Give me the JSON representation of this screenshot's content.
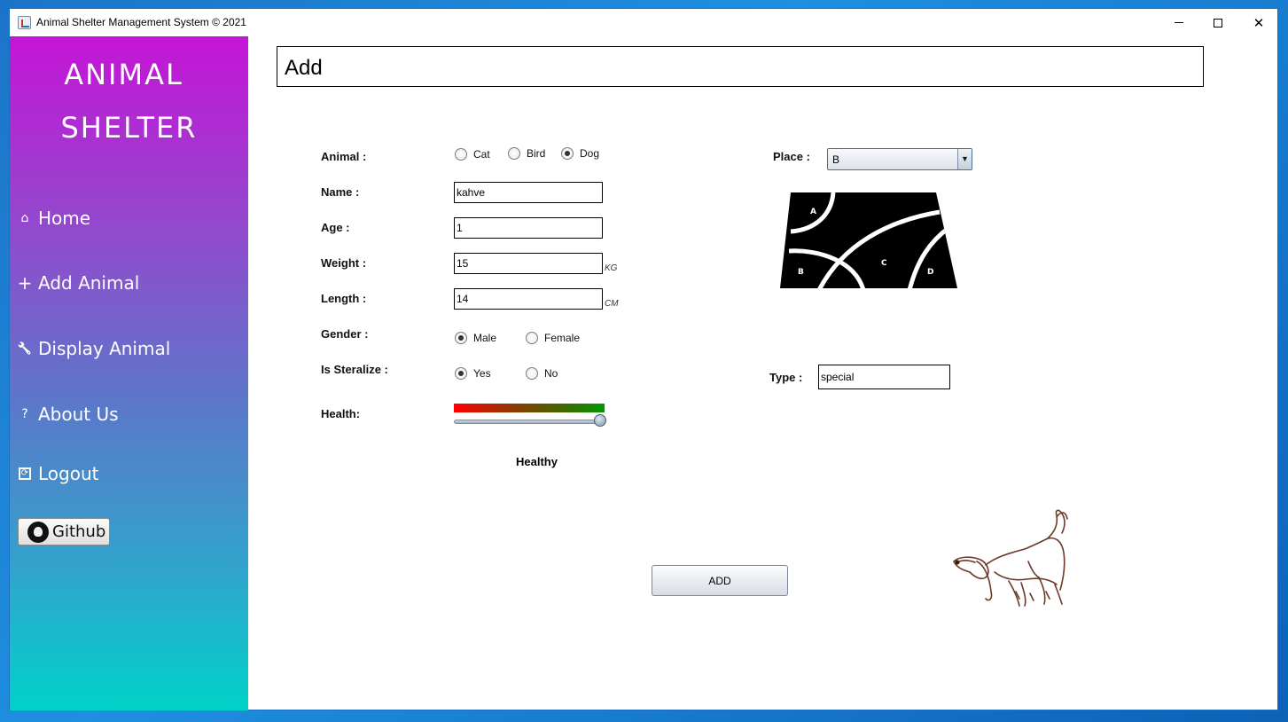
{
  "window": {
    "title": "Animal Shelter Management System © 2021",
    "controls": {
      "minimize": "minimize-icon",
      "maximize": "maximize-icon",
      "close": "✕"
    }
  },
  "sidebar": {
    "brand_line1": "ANIMAL",
    "brand_line2": "SHELTER",
    "items": [
      {
        "icon": "⌂",
        "label": "Home"
      },
      {
        "icon": "+",
        "label": "Add Animal"
      },
      {
        "icon": "🔧",
        "label": "Display Animal"
      },
      {
        "icon": "?",
        "label": "About Us"
      },
      {
        "icon": "⟳",
        "label": "Logout"
      }
    ],
    "github_label": "Github"
  },
  "header": {
    "title": "Add"
  },
  "form": {
    "animal": {
      "label": "Animal :",
      "options": [
        "Cat",
        "Bird",
        "Dog"
      ],
      "selected": "Dog"
    },
    "name": {
      "label": "Name :",
      "value": "kahve"
    },
    "age": {
      "label": "Age :",
      "value": "1"
    },
    "weight": {
      "label": "Weight :",
      "value": "15",
      "unit": "KG"
    },
    "length": {
      "label": "Length :",
      "value": "14",
      "unit": "CM"
    },
    "gender": {
      "label": "Gender :",
      "options": [
        "Male",
        "Female"
      ],
      "selected": "Male"
    },
    "sterilize": {
      "label": "Is Steralize :",
      "options": [
        "Yes",
        "No"
      ],
      "selected": "Yes"
    },
    "health": {
      "label": "Health:",
      "level": 1.0,
      "status": "Healthy"
    },
    "place": {
      "label": "Place :",
      "value": "B",
      "map_sections": [
        "A",
        "B",
        "C",
        "D"
      ]
    },
    "type": {
      "label": "Type :",
      "value": "special"
    },
    "submit_label": "ADD"
  },
  "colors": {
    "sidebar_top": "#c415d6",
    "sidebar_bottom": "#00d2c8",
    "health_low": "#ff0000",
    "health_high": "#009900"
  }
}
